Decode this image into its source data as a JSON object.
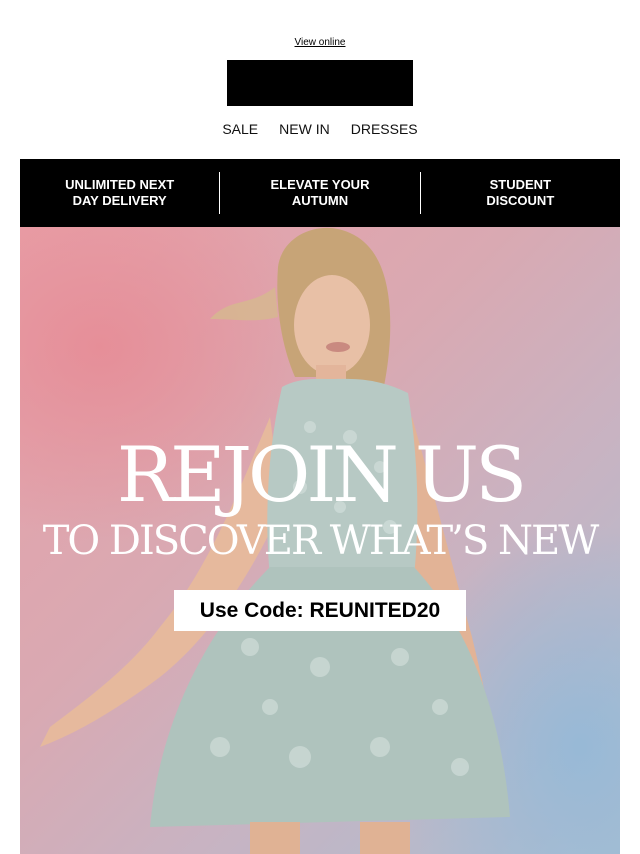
{
  "header": {
    "view_online": "View online"
  },
  "nav": {
    "items": [
      "SALE",
      "NEW IN",
      "DRESSES"
    ]
  },
  "usp_bar": {
    "items": [
      "UNLIMITED NEXT\nDAY DELIVERY",
      "ELEVATE YOUR\nAUTUMN",
      "STUDENT\nDISCOUNT"
    ]
  },
  "hero": {
    "headline": "REJOIN US",
    "subheadline": "TO DISCOVER WHAT’S NEW",
    "code_text": "Use Code: REUNITED20",
    "image_subject": "woman-in-lace-dress"
  },
  "colors": {
    "bar_background": "#000000",
    "hero_pink": "#e9a0a8",
    "hero_blue": "#a9bfd2",
    "dress_mint": "#b7c9c4"
  }
}
